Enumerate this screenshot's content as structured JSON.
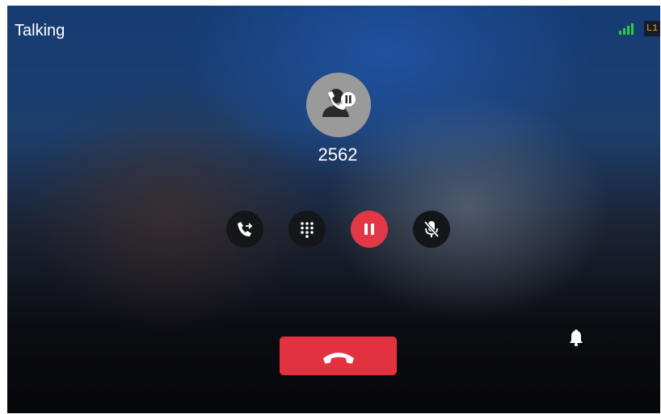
{
  "status": {
    "call_state": "Talking",
    "line_label": "L1"
  },
  "caller": {
    "number": "2562"
  },
  "controls": [
    {
      "icon": "transfer-icon"
    },
    {
      "icon": "dialpad-icon"
    },
    {
      "icon": "hold-icon"
    },
    {
      "icon": "mute-icon"
    }
  ],
  "end_call": {
    "icon": "end-call-icon",
    "color": "#e2323f"
  },
  "dnd": {
    "icon": "bell-icon"
  },
  "colors": {
    "hold_button": "#e23845",
    "signal": "#2ecc40",
    "line_badge_text": "#d9a62a"
  }
}
